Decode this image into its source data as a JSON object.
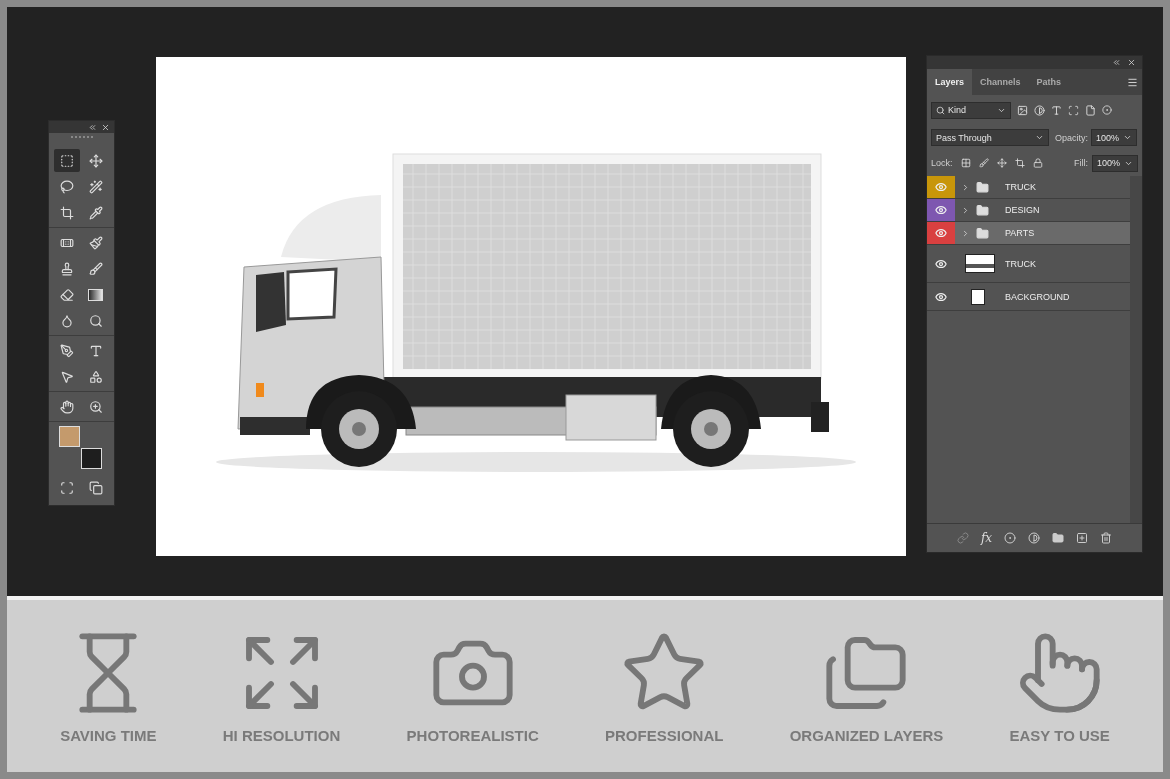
{
  "toolbox": {
    "tools": [
      {
        "selected": true
      },
      {
        "selected": false
      },
      {
        "selected": false
      },
      {
        "selected": false
      },
      {
        "selected": false
      },
      {
        "selected": false
      },
      {
        "selected": false
      },
      {
        "selected": false
      },
      {
        "selected": false
      },
      {
        "selected": false
      },
      {
        "selected": false
      },
      {
        "selected": false
      },
      {
        "selected": false
      },
      {
        "selected": false
      },
      {
        "selected": false
      },
      {
        "selected": false
      },
      {
        "selected": false
      },
      {
        "selected": false
      },
      {
        "selected": false
      },
      {
        "selected": false
      }
    ],
    "swatches": [
      {
        "color": "#c49a6c"
      },
      {
        "color": "#1e1e1e"
      }
    ]
  },
  "layers_panel": {
    "tabs": [
      {
        "label": "Layers",
        "selected": true
      },
      {
        "label": "Channels",
        "selected": false
      },
      {
        "label": "Paths",
        "selected": false
      }
    ],
    "filter": "Kind",
    "blend_mode": "Pass Through",
    "opacity_label": "Opacity:",
    "opacity": "100%",
    "lock_label": "Lock:",
    "fill_label": "Fill:",
    "fill": "100%",
    "layers": [
      {
        "name": "TRUCK",
        "kind": "group",
        "color": "#c8960a",
        "selected": false
      },
      {
        "name": "DESIGN",
        "kind": "group",
        "color": "#7e57b0",
        "selected": false
      },
      {
        "name": "PARTS",
        "kind": "group",
        "color": "#d94040",
        "selected": true
      },
      {
        "name": "TRUCK",
        "kind": "image",
        "selected": false
      },
      {
        "name": "BACKGROUND",
        "kind": "fill",
        "selected": false
      }
    ],
    "effects_label": "fx"
  },
  "features": [
    "SAVING TIME",
    "HI RESOLUTION",
    "PHOTOREALISTIC",
    "PROFESSIONAL",
    "ORGANIZED LAYERS",
    "EASY TO USE"
  ]
}
